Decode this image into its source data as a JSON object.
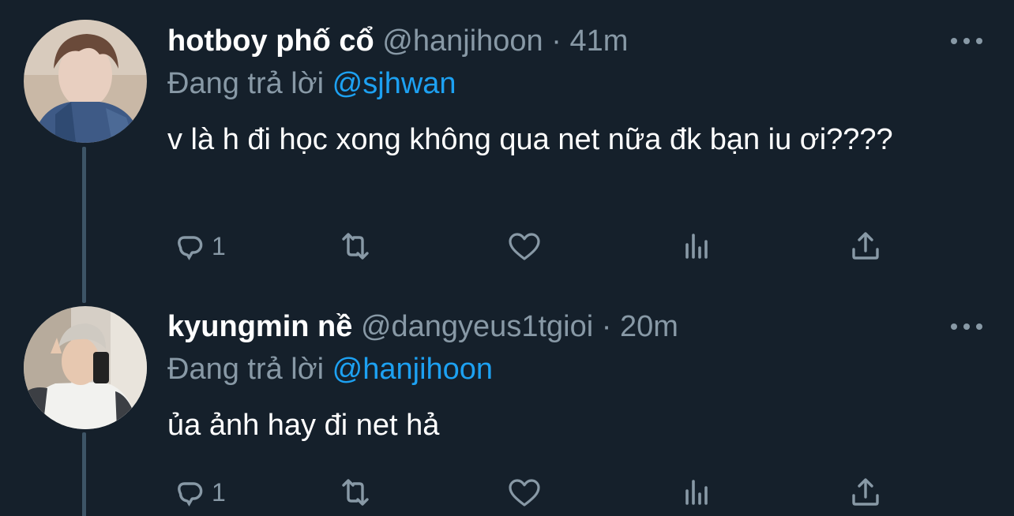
{
  "tweets": [
    {
      "name": "hotboy phố cổ",
      "handle": "@hanjihoon",
      "separator": "·",
      "time": "41m",
      "reply_prefix": "Đang trả lời",
      "reply_to": "@sjhwan",
      "body": "v là h đi học xong không qua net nữa đk bạn iu ơi????",
      "reply_count": "1"
    },
    {
      "name": "kyungmin nề",
      "handle": "@dangyeus1tgioi",
      "separator": "·",
      "time": "20m",
      "reply_prefix": "Đang trả lời",
      "reply_to": "@hanjihoon",
      "body": "ủa ảnh hay đi net hả",
      "reply_count": "1"
    }
  ],
  "icons": {
    "more": "more-dots-icon",
    "reply": "reply-bubble-icon",
    "retweet": "retweet-icon",
    "like": "heart-icon",
    "stats": "analytics-icon",
    "share": "share-icon"
  },
  "colors": {
    "background": "#15202b",
    "secondary_text": "#8899a6",
    "link": "#1da1f2",
    "thread_line": "#3d5466"
  }
}
